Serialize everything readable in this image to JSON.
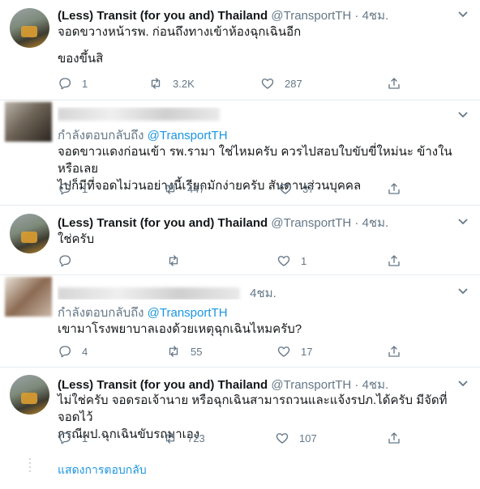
{
  "tweets": [
    {
      "name": "(Less) Transit (for you and) Thailand",
      "handle": "@TransportTH",
      "dot": "·",
      "time": "4ชม.",
      "lines": [
        "จอดขวางหน้ารพ. ก่อนถึงทางเข้าห้องฉุกเฉินอีก",
        "",
        "ของขึ้นสิ"
      ],
      "replies": "1",
      "retweets": "3.2K",
      "likes": "287"
    },
    {
      "replying_prefix": "กำลังตอบกลับถึง",
      "replying_to": "@TransportTH",
      "lines": [
        "จอดขาวแดงก่อนเข้า รพ.รามา ใช่ไหมครับ ควรไปสอบใบขับขี่ใหม่นะ ข้างในหรือเลย",
        "ไปก็มีที่จอดไม่วนอย่างนี้เรียกมักง่ายครับ สันดานส่วนบุคคล"
      ],
      "replies": "1",
      "retweets": "447",
      "likes": "37"
    },
    {
      "name": "(Less) Transit (for you and) Thailand",
      "handle": "@TransportTH",
      "dot": "·",
      "time": "4ชม.",
      "lines": [
        "ใช่ครับ"
      ],
      "replies": "",
      "retweets": "",
      "likes": "1"
    },
    {
      "time": "4ชม.",
      "replying_prefix": "กำลังตอบกลับถึง",
      "replying_to": "@TransportTH",
      "lines": [
        "เขามาโรงพยาบาลเองด้วยเหตุฉุกเฉินไหมครับ?"
      ],
      "replies": "4",
      "retweets": "55",
      "likes": "17"
    },
    {
      "name": "(Less) Transit (for you and) Thailand",
      "handle": "@TransportTH",
      "dot": "·",
      "time": "4ชม.",
      "lines": [
        "ไม่ใช่ครับ จอดรอเจ้านาย หรือฉุกเฉินสามารถวนและแจ้งรปภ.ได้ครับ มีจัดที่จอดไว้",
        "กรณีผป.ฉุกเฉินขับรถมาเอง"
      ],
      "replies": "1",
      "retweets": "723",
      "likes": "107"
    }
  ],
  "show_replies": "แสดงการตอบกลับ",
  "icons": [
    "reply-icon",
    "retweet-icon",
    "like-icon",
    "share-icon",
    "caret-down-icon"
  ],
  "colors": {
    "link": "#1b95e0",
    "muted": "#657786",
    "text": "#14171a",
    "divider": "#e6ecf0"
  }
}
